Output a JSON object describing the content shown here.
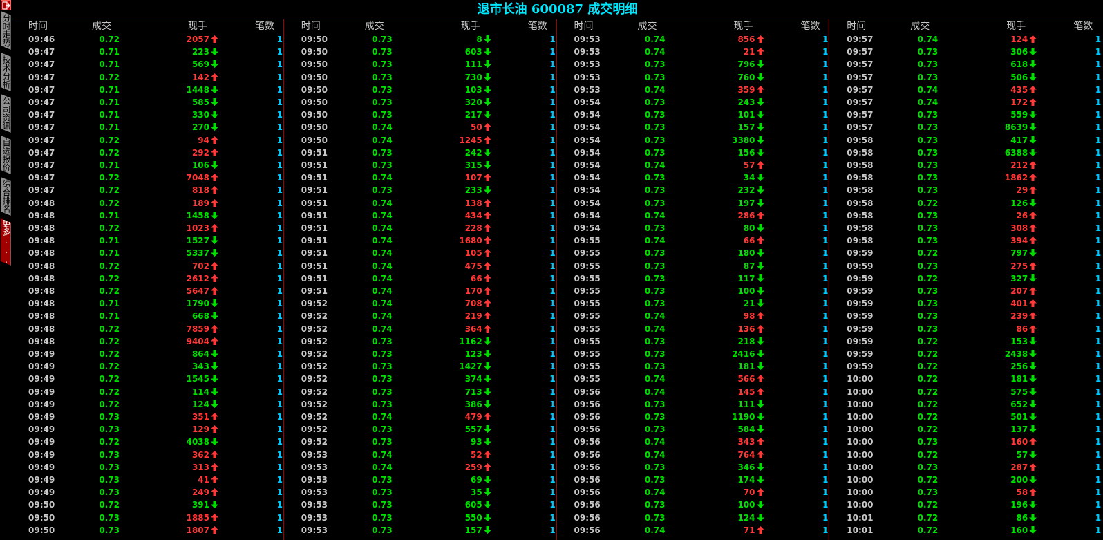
{
  "title": "退市长油 600087 成交明细",
  "sidebar": {
    "exit_icon": "exit-icon",
    "tabs": [
      "分时走势",
      "技术分析",
      "公司资讯",
      "自选报价",
      "综合排名",
      "更多..."
    ]
  },
  "headers": [
    "时间",
    "成交",
    "现手",
    "笔数"
  ],
  "colors": {
    "up": "#ff3838",
    "down": "#00e000",
    "time": "#c8c8c8",
    "count": "#00c8ff",
    "title": "#00e8ff",
    "divider": "#a00000"
  },
  "panels": [
    {
      "rows": [
        [
          "09:46",
          "0.72",
          "2057",
          "up",
          "1"
        ],
        [
          "09:47",
          "0.71",
          "223",
          "down",
          "1"
        ],
        [
          "09:47",
          "0.71",
          "569",
          "down",
          "1"
        ],
        [
          "09:47",
          "0.72",
          "142",
          "up",
          "1"
        ],
        [
          "09:47",
          "0.71",
          "1448",
          "down",
          "1"
        ],
        [
          "09:47",
          "0.71",
          "585",
          "down",
          "1"
        ],
        [
          "09:47",
          "0.71",
          "330",
          "down",
          "1"
        ],
        [
          "09:47",
          "0.71",
          "270",
          "down",
          "1"
        ],
        [
          "09:47",
          "0.72",
          "94",
          "up",
          "1"
        ],
        [
          "09:47",
          "0.72",
          "292",
          "up",
          "1"
        ],
        [
          "09:47",
          "0.71",
          "106",
          "down",
          "1"
        ],
        [
          "09:47",
          "0.72",
          "7048",
          "up",
          "1"
        ],
        [
          "09:47",
          "0.72",
          "818",
          "up",
          "1"
        ],
        [
          "09:48",
          "0.72",
          "189",
          "up",
          "1"
        ],
        [
          "09:48",
          "0.71",
          "1458",
          "down",
          "1"
        ],
        [
          "09:48",
          "0.72",
          "1023",
          "up",
          "1"
        ],
        [
          "09:48",
          "0.71",
          "1527",
          "down",
          "1"
        ],
        [
          "09:48",
          "0.71",
          "5337",
          "down",
          "1"
        ],
        [
          "09:48",
          "0.72",
          "702",
          "up",
          "1"
        ],
        [
          "09:48",
          "0.72",
          "2612",
          "up",
          "1"
        ],
        [
          "09:48",
          "0.72",
          "5647",
          "up",
          "1"
        ],
        [
          "09:48",
          "0.71",
          "1790",
          "down",
          "1"
        ],
        [
          "09:48",
          "0.71",
          "668",
          "down",
          "1"
        ],
        [
          "09:48",
          "0.72",
          "7859",
          "up",
          "1"
        ],
        [
          "09:48",
          "0.72",
          "9404",
          "up",
          "1"
        ],
        [
          "09:49",
          "0.72",
          "864",
          "down",
          "1"
        ],
        [
          "09:49",
          "0.72",
          "343",
          "down",
          "1"
        ],
        [
          "09:49",
          "0.72",
          "1545",
          "down",
          "1"
        ],
        [
          "09:49",
          "0.72",
          "114",
          "down",
          "1"
        ],
        [
          "09:49",
          "0.72",
          "124",
          "down",
          "1"
        ],
        [
          "09:49",
          "0.73",
          "351",
          "up",
          "1"
        ],
        [
          "09:49",
          "0.73",
          "129",
          "up",
          "1"
        ],
        [
          "09:49",
          "0.72",
          "4038",
          "down",
          "1"
        ],
        [
          "09:49",
          "0.73",
          "362",
          "up",
          "1"
        ],
        [
          "09:49",
          "0.73",
          "313",
          "up",
          "1"
        ],
        [
          "09:49",
          "0.73",
          "41",
          "up",
          "1"
        ],
        [
          "09:49",
          "0.73",
          "249",
          "up",
          "1"
        ],
        [
          "09:50",
          "0.72",
          "391",
          "down",
          "1"
        ],
        [
          "09:50",
          "0.73",
          "1885",
          "up",
          "1"
        ],
        [
          "09:50",
          "0.73",
          "1807",
          "up",
          "1"
        ]
      ]
    },
    {
      "rows": [
        [
          "09:50",
          "0.73",
          "8",
          "down",
          "1"
        ],
        [
          "09:50",
          "0.73",
          "603",
          "down",
          "1"
        ],
        [
          "09:50",
          "0.73",
          "111",
          "down",
          "1"
        ],
        [
          "09:50",
          "0.73",
          "730",
          "down",
          "1"
        ],
        [
          "09:50",
          "0.73",
          "103",
          "down",
          "1"
        ],
        [
          "09:50",
          "0.73",
          "320",
          "down",
          "1"
        ],
        [
          "09:50",
          "0.73",
          "217",
          "down",
          "1"
        ],
        [
          "09:50",
          "0.74",
          "50",
          "up",
          "1"
        ],
        [
          "09:50",
          "0.74",
          "1245",
          "up",
          "1"
        ],
        [
          "09:51",
          "0.73",
          "242",
          "down",
          "1"
        ],
        [
          "09:51",
          "0.73",
          "315",
          "down",
          "1"
        ],
        [
          "09:51",
          "0.74",
          "107",
          "up",
          "1"
        ],
        [
          "09:51",
          "0.73",
          "233",
          "down",
          "1"
        ],
        [
          "09:51",
          "0.74",
          "138",
          "up",
          "1"
        ],
        [
          "09:51",
          "0.74",
          "434",
          "up",
          "1"
        ],
        [
          "09:51",
          "0.74",
          "228",
          "up",
          "1"
        ],
        [
          "09:51",
          "0.74",
          "1680",
          "up",
          "1"
        ],
        [
          "09:51",
          "0.74",
          "105",
          "up",
          "1"
        ],
        [
          "09:51",
          "0.74",
          "475",
          "up",
          "1"
        ],
        [
          "09:51",
          "0.74",
          "66",
          "up",
          "1"
        ],
        [
          "09:51",
          "0.74",
          "170",
          "up",
          "1"
        ],
        [
          "09:52",
          "0.74",
          "708",
          "up",
          "1"
        ],
        [
          "09:52",
          "0.74",
          "219",
          "up",
          "1"
        ],
        [
          "09:52",
          "0.74",
          "364",
          "up",
          "1"
        ],
        [
          "09:52",
          "0.73",
          "1162",
          "down",
          "1"
        ],
        [
          "09:52",
          "0.73",
          "123",
          "down",
          "1"
        ],
        [
          "09:52",
          "0.73",
          "1427",
          "down",
          "1"
        ],
        [
          "09:52",
          "0.73",
          "374",
          "down",
          "1"
        ],
        [
          "09:52",
          "0.73",
          "713",
          "down",
          "1"
        ],
        [
          "09:52",
          "0.73",
          "386",
          "down",
          "1"
        ],
        [
          "09:52",
          "0.74",
          "479",
          "up",
          "1"
        ],
        [
          "09:52",
          "0.73",
          "557",
          "down",
          "1"
        ],
        [
          "09:52",
          "0.73",
          "93",
          "down",
          "1"
        ],
        [
          "09:53",
          "0.74",
          "52",
          "up",
          "1"
        ],
        [
          "09:53",
          "0.74",
          "259",
          "up",
          "1"
        ],
        [
          "09:53",
          "0.73",
          "69",
          "down",
          "1"
        ],
        [
          "09:53",
          "0.73",
          "35",
          "down",
          "1"
        ],
        [
          "09:53",
          "0.73",
          "605",
          "down",
          "1"
        ],
        [
          "09:53",
          "0.73",
          "550",
          "down",
          "1"
        ],
        [
          "09:53",
          "0.73",
          "157",
          "down",
          "1"
        ]
      ]
    },
    {
      "rows": [
        [
          "09:53",
          "0.74",
          "856",
          "up",
          "1"
        ],
        [
          "09:53",
          "0.74",
          "21",
          "up",
          "1"
        ],
        [
          "09:53",
          "0.73",
          "796",
          "down",
          "1"
        ],
        [
          "09:53",
          "0.73",
          "760",
          "down",
          "1"
        ],
        [
          "09:53",
          "0.74",
          "359",
          "up",
          "1"
        ],
        [
          "09:54",
          "0.73",
          "243",
          "down",
          "1"
        ],
        [
          "09:54",
          "0.73",
          "101",
          "down",
          "1"
        ],
        [
          "09:54",
          "0.73",
          "157",
          "down",
          "1"
        ],
        [
          "09:54",
          "0.73",
          "3380",
          "down",
          "1"
        ],
        [
          "09:54",
          "0.73",
          "156",
          "down",
          "1"
        ],
        [
          "09:54",
          "0.74",
          "57",
          "up",
          "1"
        ],
        [
          "09:54",
          "0.73",
          "34",
          "down",
          "1"
        ],
        [
          "09:54",
          "0.73",
          "232",
          "down",
          "1"
        ],
        [
          "09:54",
          "0.73",
          "197",
          "down",
          "1"
        ],
        [
          "09:54",
          "0.74",
          "286",
          "up",
          "1"
        ],
        [
          "09:54",
          "0.73",
          "80",
          "down",
          "1"
        ],
        [
          "09:55",
          "0.74",
          "66",
          "up",
          "1"
        ],
        [
          "09:55",
          "0.73",
          "180",
          "down",
          "1"
        ],
        [
          "09:55",
          "0.73",
          "87",
          "down",
          "1"
        ],
        [
          "09:55",
          "0.73",
          "117",
          "down",
          "1"
        ],
        [
          "09:55",
          "0.73",
          "100",
          "down",
          "1"
        ],
        [
          "09:55",
          "0.73",
          "21",
          "down",
          "1"
        ],
        [
          "09:55",
          "0.74",
          "98",
          "up",
          "1"
        ],
        [
          "09:55",
          "0.74",
          "136",
          "up",
          "1"
        ],
        [
          "09:55",
          "0.73",
          "218",
          "down",
          "1"
        ],
        [
          "09:55",
          "0.73",
          "2416",
          "down",
          "1"
        ],
        [
          "09:55",
          "0.73",
          "181",
          "down",
          "1"
        ],
        [
          "09:55",
          "0.74",
          "566",
          "up",
          "1"
        ],
        [
          "09:56",
          "0.74",
          "145",
          "up",
          "1"
        ],
        [
          "09:56",
          "0.73",
          "111",
          "down",
          "1"
        ],
        [
          "09:56",
          "0.73",
          "1190",
          "down",
          "1"
        ],
        [
          "09:56",
          "0.73",
          "584",
          "down",
          "1"
        ],
        [
          "09:56",
          "0.74",
          "343",
          "up",
          "1"
        ],
        [
          "09:56",
          "0.74",
          "764",
          "up",
          "1"
        ],
        [
          "09:56",
          "0.73",
          "346",
          "down",
          "1"
        ],
        [
          "09:56",
          "0.73",
          "174",
          "down",
          "1"
        ],
        [
          "09:56",
          "0.74",
          "70",
          "up",
          "1"
        ],
        [
          "09:56",
          "0.73",
          "100",
          "down",
          "1"
        ],
        [
          "09:56",
          "0.73",
          "124",
          "down",
          "1"
        ],
        [
          "09:56",
          "0.74",
          "71",
          "up",
          "1"
        ]
      ]
    },
    {
      "rows": [
        [
          "09:57",
          "0.74",
          "124",
          "up",
          "1"
        ],
        [
          "09:57",
          "0.73",
          "306",
          "down",
          "1"
        ],
        [
          "09:57",
          "0.73",
          "618",
          "down",
          "1"
        ],
        [
          "09:57",
          "0.73",
          "506",
          "down",
          "1"
        ],
        [
          "09:57",
          "0.74",
          "435",
          "up",
          "1"
        ],
        [
          "09:57",
          "0.74",
          "172",
          "up",
          "1"
        ],
        [
          "09:57",
          "0.73",
          "559",
          "down",
          "1"
        ],
        [
          "09:57",
          "0.73",
          "8639",
          "down",
          "1"
        ],
        [
          "09:58",
          "0.73",
          "417",
          "down",
          "1"
        ],
        [
          "09:58",
          "0.73",
          "6388",
          "down",
          "1"
        ],
        [
          "09:58",
          "0.73",
          "212",
          "up",
          "1"
        ],
        [
          "09:58",
          "0.73",
          "1862",
          "up",
          "1"
        ],
        [
          "09:58",
          "0.73",
          "29",
          "up",
          "1"
        ],
        [
          "09:58",
          "0.72",
          "126",
          "down",
          "1"
        ],
        [
          "09:58",
          "0.73",
          "26",
          "up",
          "1"
        ],
        [
          "09:58",
          "0.73",
          "308",
          "up",
          "1"
        ],
        [
          "09:58",
          "0.73",
          "394",
          "up",
          "1"
        ],
        [
          "09:59",
          "0.72",
          "797",
          "down",
          "1"
        ],
        [
          "09:59",
          "0.73",
          "275",
          "up",
          "1"
        ],
        [
          "09:59",
          "0.72",
          "327",
          "down",
          "1"
        ],
        [
          "09:59",
          "0.73",
          "207",
          "up",
          "1"
        ],
        [
          "09:59",
          "0.73",
          "401",
          "up",
          "1"
        ],
        [
          "09:59",
          "0.73",
          "239",
          "up",
          "1"
        ],
        [
          "09:59",
          "0.73",
          "86",
          "up",
          "1"
        ],
        [
          "09:59",
          "0.72",
          "153",
          "down",
          "1"
        ],
        [
          "09:59",
          "0.72",
          "2438",
          "down",
          "1"
        ],
        [
          "09:59",
          "0.72",
          "256",
          "down",
          "1"
        ],
        [
          "10:00",
          "0.72",
          "181",
          "down",
          "1"
        ],
        [
          "10:00",
          "0.72",
          "575",
          "down",
          "1"
        ],
        [
          "10:00",
          "0.72",
          "652",
          "down",
          "1"
        ],
        [
          "10:00",
          "0.72",
          "501",
          "down",
          "1"
        ],
        [
          "10:00",
          "0.72",
          "137",
          "down",
          "1"
        ],
        [
          "10:00",
          "0.73",
          "160",
          "up",
          "1"
        ],
        [
          "10:00",
          "0.72",
          "57",
          "down",
          "1"
        ],
        [
          "10:00",
          "0.73",
          "287",
          "up",
          "1"
        ],
        [
          "10:00",
          "0.72",
          "200",
          "down",
          "1"
        ],
        [
          "10:00",
          "0.73",
          "58",
          "up",
          "1"
        ],
        [
          "10:00",
          "0.72",
          "196",
          "down",
          "1"
        ],
        [
          "10:01",
          "0.72",
          "86",
          "down",
          "1"
        ],
        [
          "10:01",
          "0.72",
          "160",
          "down",
          "1"
        ]
      ]
    }
  ]
}
